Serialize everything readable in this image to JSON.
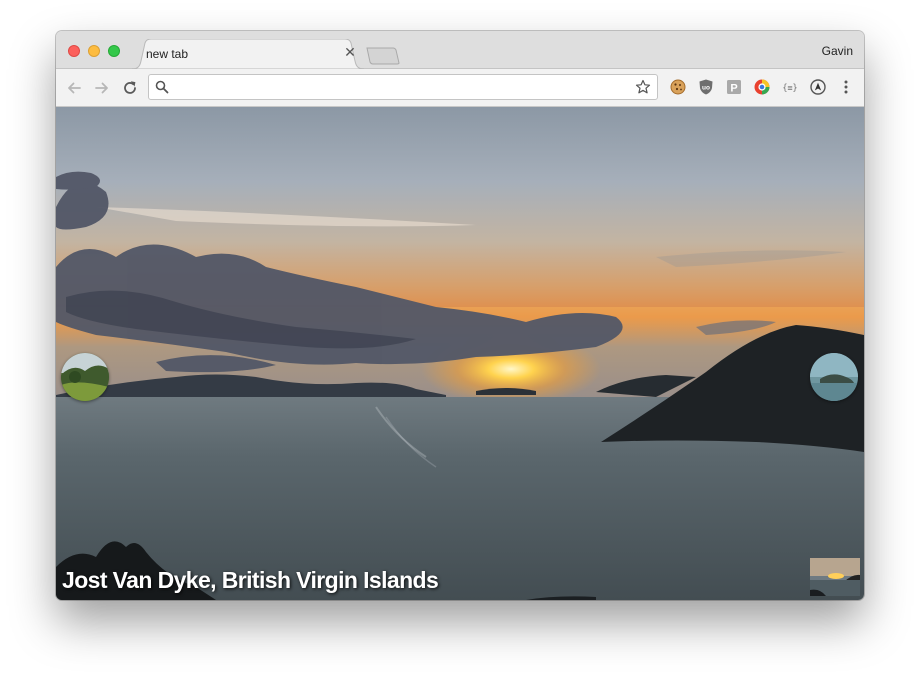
{
  "browser": {
    "tab_title": "new tab",
    "profile_name": "Gavin"
  },
  "toolbar": {
    "address_value": "",
    "nav_icons": [
      "back-arrow-icon",
      "forward-arrow-icon",
      "reload-icon"
    ],
    "extensions": [
      "cookie-extension-icon",
      "ublock-origin-icon",
      "p-extension-icon",
      "colorful-circle-extension-icon",
      "json-braces-extension-icon",
      "a-circle-extension-icon",
      "more-vertical-icon"
    ]
  },
  "new_tab_page": {
    "caption": "Jost Van Dyke, British Virgin Islands"
  },
  "colors": {
    "titlebar": "#dedede",
    "toolbar": "#f2f2f2",
    "sky_top": "#8f9ba8",
    "sunset": "#f2a23b",
    "water": "#4f5c62"
  }
}
